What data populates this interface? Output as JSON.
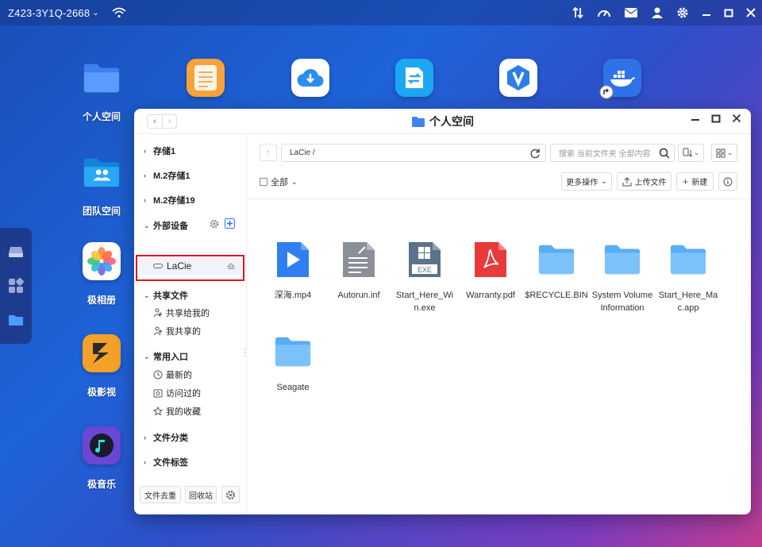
{
  "topbar": {
    "device_name": "Z423-3Y1Q-2668",
    "chevron": "⌄"
  },
  "desktop": {
    "apps": [
      {
        "label": "个人空间",
        "icon": "folder-icon",
        "color": "#4a86f0"
      },
      {
        "label": "",
        "icon": "notes-icon",
        "color": "#f59a2c"
      },
      {
        "label": "",
        "icon": "cloud-download-icon",
        "color": "#2b8bf0"
      },
      {
        "label": "",
        "icon": "transfer-icon",
        "color": "#1aa3f0"
      },
      {
        "label": "",
        "icon": "v-logo-icon",
        "color": "#2b7de9"
      },
      {
        "label": "",
        "icon": "docker-icon",
        "color": "#2e72e8"
      },
      {
        "label": "团队空间",
        "icon": "team-folder-icon",
        "color": "#1fa0f0"
      },
      {
        "label": "极相册",
        "icon": "photos-icon",
        "color": "#ffffff"
      },
      {
        "label": "极影视",
        "icon": "video-icon",
        "color": "#f3a12a"
      },
      {
        "label": "极音乐",
        "icon": "music-icon",
        "color": "#7a4bd8"
      }
    ]
  },
  "window": {
    "title": "个人空间",
    "nav_back": "‹",
    "nav_forward": "›"
  },
  "sidebar": {
    "storage1": "存储1",
    "m2_storage1": "M.2存储1",
    "m2_storage19": "M.2存储19",
    "external_devices": "外部设备",
    "lacie": "LaCie",
    "shared_files": "共享文件",
    "shared_with_me": "共享给我的",
    "my_shares": "我共享的",
    "common_entry": "常用入口",
    "recent": "最新的",
    "visited": "访问过的",
    "favorites": "我的收藏",
    "file_category": "文件分类",
    "file_tags": "文件标签",
    "dedupe_button": "文件去重",
    "recycle_button": "回收站"
  },
  "main": {
    "path": "LaCie /",
    "search_placeholder": "搜索 当前文件夹 全部内容",
    "select_all": "全部",
    "more_actions": "更多操作",
    "upload": "上传文件",
    "new": "新建",
    "files": [
      {
        "name": "深海.mp4",
        "icon": "video-file-icon"
      },
      {
        "name": "Autorun.inf",
        "icon": "text-file-icon"
      },
      {
        "name": "Start_Here_Win.exe",
        "icon": "exe-file-icon"
      },
      {
        "name": "Warranty.pdf",
        "icon": "pdf-file-icon"
      },
      {
        "name": "$RECYCLE.BIN",
        "icon": "folder-icon"
      },
      {
        "name": "System Volume Information",
        "icon": "folder-icon"
      },
      {
        "name": "Start_Here_Mac.app",
        "icon": "folder-icon"
      },
      {
        "name": "Seagate",
        "icon": "folder-icon"
      }
    ]
  }
}
